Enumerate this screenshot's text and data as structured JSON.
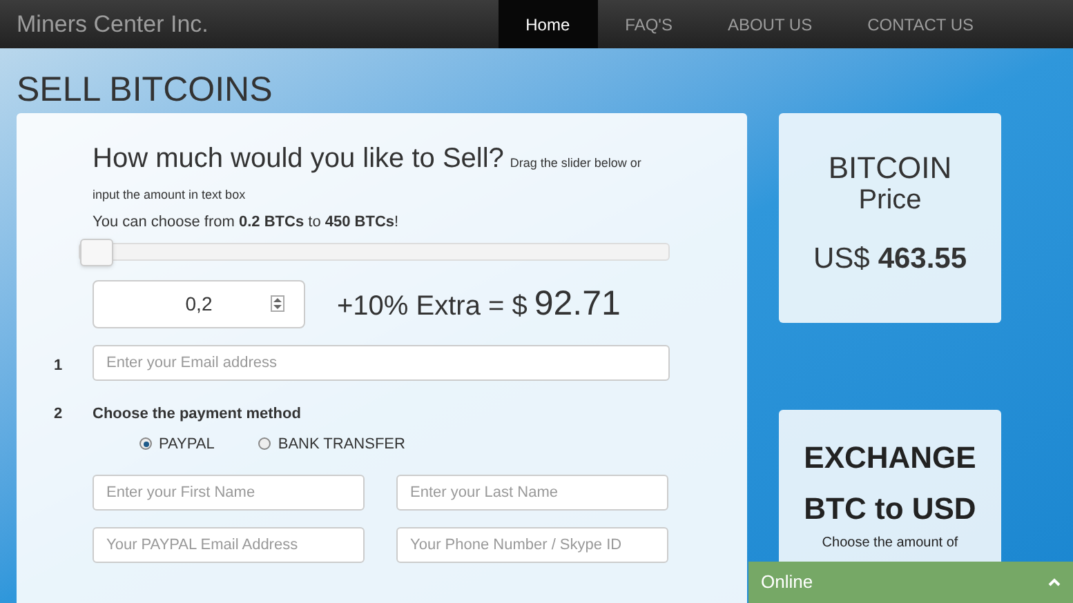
{
  "navbar": {
    "brand": "Miners Center Inc.",
    "links": [
      {
        "label": "Home",
        "selected": true
      },
      {
        "label": "FAQ'S",
        "selected": false
      },
      {
        "label": "ABOUT US",
        "selected": false
      },
      {
        "label": "CONTACT US",
        "selected": false
      }
    ]
  },
  "page_title": "SELL BITCOINS",
  "sell_form": {
    "question": "How much would you like to Sell?",
    "hint": "Drag the slider below or input the amount in text box",
    "range_note": "You can choose from **0.2 BTCs** to **450 BTCs**!",
    "slider": {
      "level": 0
    },
    "amount": {
      "value": "0,2"
    },
    "extra_label": "+10% Extra = $",
    "extra_value": "92.71",
    "steps": [
      {
        "number": "1",
        "kind": "field",
        "placeholder": "Enter your Email address"
      },
      {
        "number": "2",
        "kind": "choice",
        "label": "Choose the payment method",
        "options": [
          {
            "label": "PAYPAL",
            "selected": true
          },
          {
            "label": "BANK TRANSFER",
            "selected": false
          }
        ]
      }
    ],
    "fields": [
      {
        "placeholder": "Enter your First Name"
      },
      {
        "placeholder": "Enter your Last Name"
      },
      {
        "placeholder": "Your PAYPAL Email Address"
      },
      {
        "placeholder": "Your Phone Number / Skype ID"
      }
    ]
  },
  "price_card": {
    "title_1": "BITCOIN",
    "title_2": "Price",
    "currency": "US$",
    "price": "463.55"
  },
  "exchange_card": {
    "title_1": "EXCHANGE",
    "title_2": "BTC to USD",
    "text": "Choose the amount of"
  },
  "chat_bar": {
    "label": "Online"
  }
}
